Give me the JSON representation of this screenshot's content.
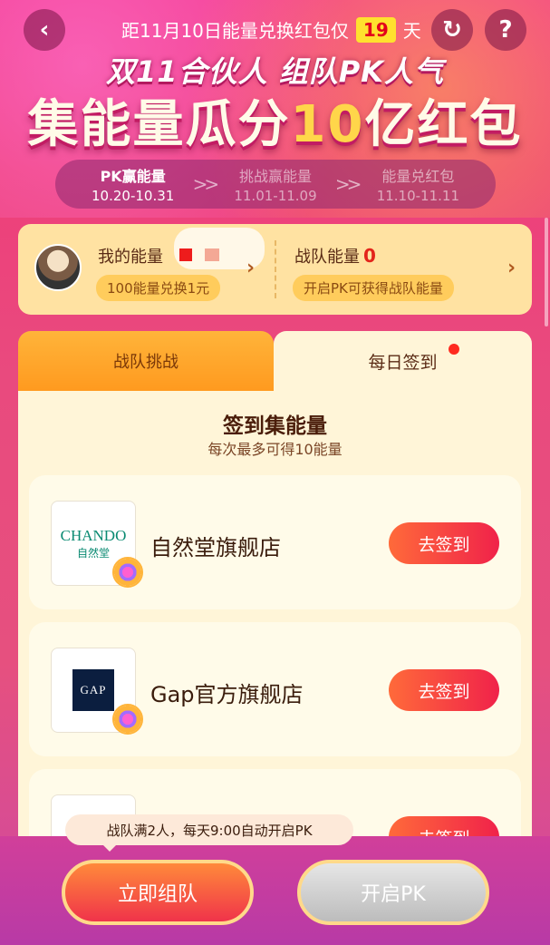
{
  "header": {
    "countdown_prefix": "距11月10日能量兑换红包仅",
    "countdown_days": "19",
    "countdown_suffix": "天",
    "back_icon": "‹",
    "refresh_icon": "↻",
    "help_icon": "?"
  },
  "hero": {
    "subtitle": "双11合伙人 组队PK人气",
    "title_part1": "集能量瓜分",
    "title_accent": "10",
    "title_part2": "亿红包"
  },
  "stages": [
    {
      "name": "PK赢能量",
      "date": "10.20-10.31"
    },
    {
      "name": "挑战赢能量",
      "date": "11.01-11.09"
    },
    {
      "name": "能量兑红包",
      "date": "11.10-11.11"
    }
  ],
  "stage_arrow": ">>",
  "energy": {
    "my_label": "我的能量",
    "my_hint": "100能量兑换1元",
    "team_label": "战队能量",
    "team_value": "0",
    "team_hint": "开启PK可获得战队能量",
    "chevron": "›"
  },
  "tabs": {
    "left": "战队挑战",
    "right": "每日签到"
  },
  "section": {
    "title": "签到集能量",
    "subtitle": "每次最多可得10能量"
  },
  "stores": [
    {
      "name": "自然堂旗舰店",
      "logo_main": "CHANDO",
      "logo_sub": "自然堂",
      "button": "去签到"
    },
    {
      "name": "Gap官方旗舰店",
      "logo_main": "GAP",
      "logo_sub": "",
      "button": "去签到"
    },
    {
      "name": "",
      "logo_main": "",
      "logo_sub": "",
      "button": "去签到"
    }
  ],
  "bottom": {
    "tooltip": "战队满2人，每天9:00自动开启PK",
    "team_button": "立即组队",
    "pk_button": "开启PK"
  },
  "colors": {
    "accent": "#f0224a",
    "gold": "#ffd64a",
    "panel": "#ffe2a2"
  }
}
